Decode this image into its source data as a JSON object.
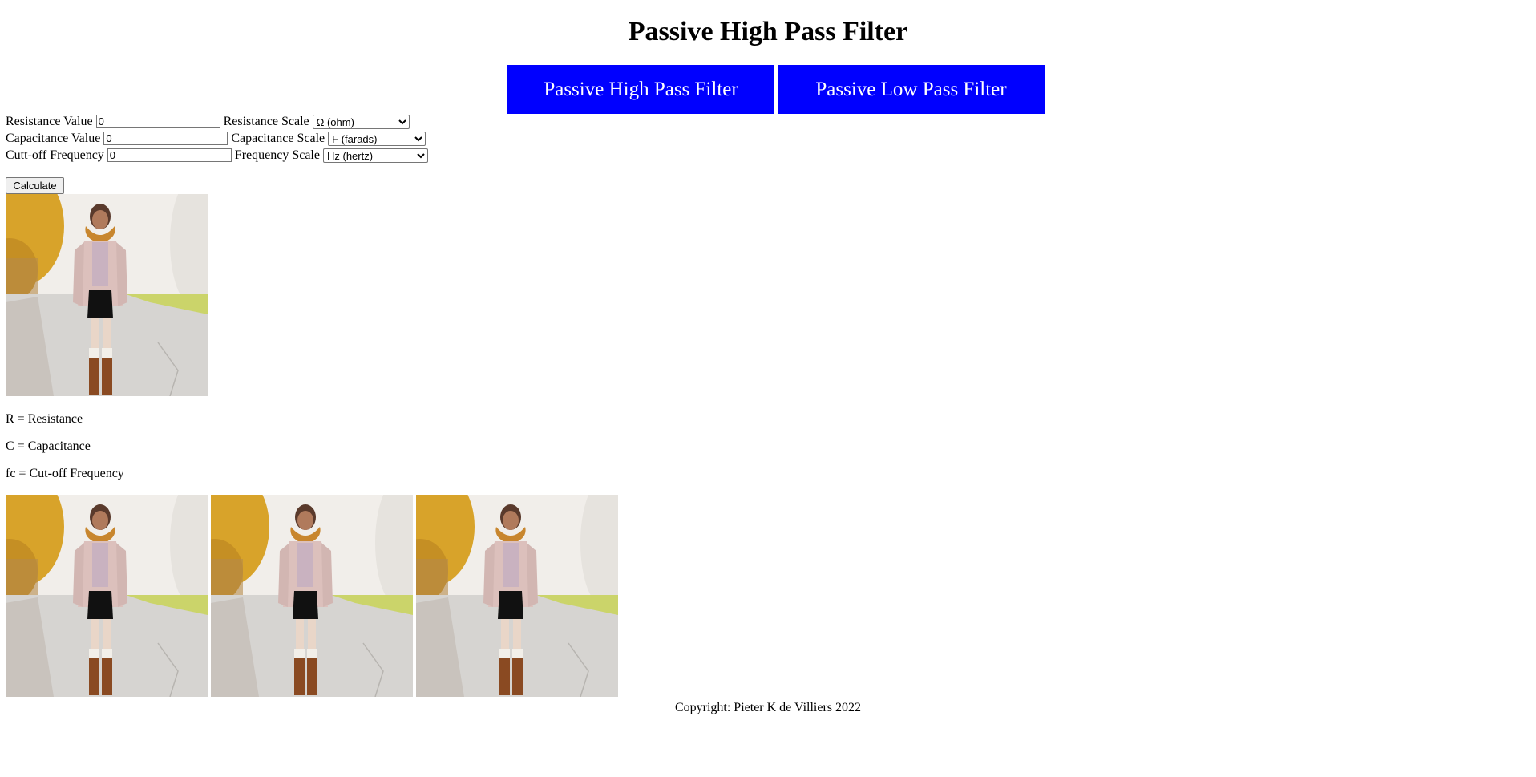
{
  "header": {
    "title": "Passive High Pass Filter"
  },
  "nav": {
    "high_pass_label": "Passive High Pass Filter",
    "low_pass_label": "Passive Low Pass Filter",
    "button_color": "#0000ff"
  },
  "form": {
    "resistance": {
      "label": "Resistance Value",
      "value": "0",
      "scale_label": "Resistance Scale",
      "scale_selected": "Ω (ohm)"
    },
    "capacitance": {
      "label": "Capacitance Value",
      "value": "0",
      "scale_label": "Capacitance Scale",
      "scale_selected": "F (farads)"
    },
    "frequency": {
      "label": "Cutt-off Frequency",
      "value": "0",
      "scale_label": "Frequency Scale",
      "scale_selected": "Hz (hertz)"
    },
    "calculate_label": "Calculate"
  },
  "legend": {
    "r": "R = Resistance",
    "c": "C = Capacitance",
    "fc": "fc = Cut-off Frequency"
  },
  "footer": {
    "copyright": "Copyright: Pieter K de Villiers 2022"
  }
}
